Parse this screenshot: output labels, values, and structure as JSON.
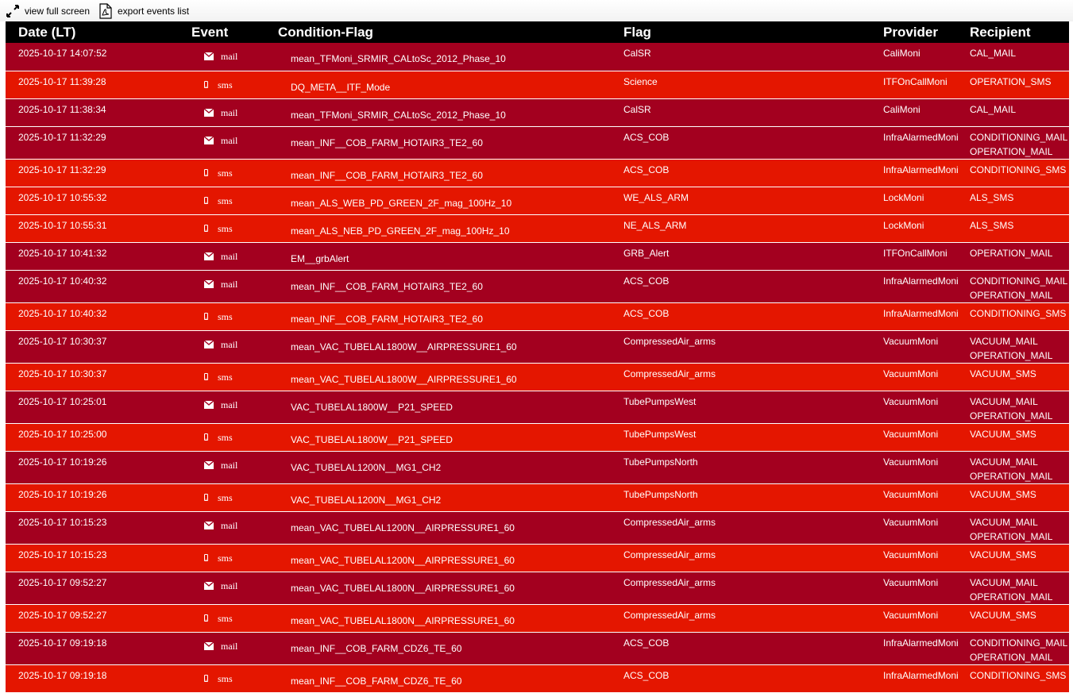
{
  "toolbar": {
    "fullscreen_label": "view full screen",
    "export_label": "export events list"
  },
  "columns": [
    "Date (LT)",
    "Event",
    "Condition-Flag",
    "Flag",
    "Provider",
    "Recipient"
  ],
  "colors": {
    "mail_row": "#a3001f",
    "sms_row": "#e41600",
    "header_bg": "#000000"
  },
  "rows": [
    {
      "date": "2025-10-17 14:07:52",
      "event": "mail",
      "condition": "mean_TFMoni_SRMIR_CALtoSc_2012_Phase_10",
      "flag": "CalSR",
      "provider": "CaliMoni",
      "recipients": [
        "CAL_MAIL"
      ]
    },
    {
      "date": "2025-10-17 11:39:28",
      "event": "sms",
      "condition": "DQ_META__ITF_Mode",
      "flag": "Science",
      "provider": "ITFOnCallMoni",
      "recipients": [
        "OPERATION_SMS"
      ]
    },
    {
      "date": "2025-10-17 11:38:34",
      "event": "mail",
      "condition": "mean_TFMoni_SRMIR_CALtoSc_2012_Phase_10",
      "flag": "CalSR",
      "provider": "CaliMoni",
      "recipients": [
        "CAL_MAIL"
      ]
    },
    {
      "date": "2025-10-17 11:32:29",
      "event": "mail",
      "condition": "mean_INF__COB_FARM_HOTAIR3_TE2_60",
      "flag": "ACS_COB",
      "provider": "InfraAlarmedMoni",
      "recipients": [
        "CONDITIONING_MAIL",
        "OPERATION_MAIL"
      ]
    },
    {
      "date": "2025-10-17 11:32:29",
      "event": "sms",
      "condition": "mean_INF__COB_FARM_HOTAIR3_TE2_60",
      "flag": "ACS_COB",
      "provider": "InfraAlarmedMoni",
      "recipients": [
        "CONDITIONING_SMS"
      ]
    },
    {
      "date": "2025-10-17 10:55:32",
      "event": "sms",
      "condition": "mean_ALS_WEB_PD_GREEN_2F_mag_100Hz_10",
      "flag": "WE_ALS_ARM",
      "provider": "LockMoni",
      "recipients": [
        "ALS_SMS"
      ]
    },
    {
      "date": "2025-10-17 10:55:31",
      "event": "sms",
      "condition": "mean_ALS_NEB_PD_GREEN_2F_mag_100Hz_10",
      "flag": "NE_ALS_ARM",
      "provider": "LockMoni",
      "recipients": [
        "ALS_SMS"
      ]
    },
    {
      "date": "2025-10-17 10:41:32",
      "event": "mail",
      "condition": "EM__grbAlert",
      "flag": "GRB_Alert",
      "provider": "ITFOnCallMoni",
      "recipients": [
        "OPERATION_MAIL"
      ]
    },
    {
      "date": "2025-10-17 10:40:32",
      "event": "mail",
      "condition": "mean_INF__COB_FARM_HOTAIR3_TE2_60",
      "flag": "ACS_COB",
      "provider": "InfraAlarmedMoni",
      "recipients": [
        "CONDITIONING_MAIL",
        "OPERATION_MAIL"
      ]
    },
    {
      "date": "2025-10-17 10:40:32",
      "event": "sms",
      "condition": "mean_INF__COB_FARM_HOTAIR3_TE2_60",
      "flag": "ACS_COB",
      "provider": "InfraAlarmedMoni",
      "recipients": [
        "CONDITIONING_SMS"
      ]
    },
    {
      "date": "2025-10-17 10:30:37",
      "event": "mail",
      "condition": "mean_VAC_TUBELAL1800W__AIRPRESSURE1_60",
      "flag": "CompressedAir_arms",
      "provider": "VacuumMoni",
      "recipients": [
        "VACUUM_MAIL",
        "OPERATION_MAIL"
      ]
    },
    {
      "date": "2025-10-17 10:30:37",
      "event": "sms",
      "condition": "mean_VAC_TUBELAL1800W__AIRPRESSURE1_60",
      "flag": "CompressedAir_arms",
      "provider": "VacuumMoni",
      "recipients": [
        "VACUUM_SMS"
      ]
    },
    {
      "date": "2025-10-17 10:25:01",
      "event": "mail",
      "condition": "VAC_TUBELAL1800W__P21_SPEED",
      "flag": "TubePumpsWest",
      "provider": "VacuumMoni",
      "recipients": [
        "VACUUM_MAIL",
        "OPERATION_MAIL"
      ]
    },
    {
      "date": "2025-10-17 10:25:00",
      "event": "sms",
      "condition": "VAC_TUBELAL1800W__P21_SPEED",
      "flag": "TubePumpsWest",
      "provider": "VacuumMoni",
      "recipients": [
        "VACUUM_SMS"
      ]
    },
    {
      "date": "2025-10-17 10:19:26",
      "event": "mail",
      "condition": "VAC_TUBELAL1200N__MG1_CH2",
      "flag": "TubePumpsNorth",
      "provider": "VacuumMoni",
      "recipients": [
        "VACUUM_MAIL",
        "OPERATION_MAIL"
      ]
    },
    {
      "date": "2025-10-17 10:19:26",
      "event": "sms",
      "condition": "VAC_TUBELAL1200N__MG1_CH2",
      "flag": "TubePumpsNorth",
      "provider": "VacuumMoni",
      "recipients": [
        "VACUUM_SMS"
      ]
    },
    {
      "date": "2025-10-17 10:15:23",
      "event": "mail",
      "condition": "mean_VAC_TUBELAL1200N__AIRPRESSURE1_60",
      "flag": "CompressedAir_arms",
      "provider": "VacuumMoni",
      "recipients": [
        "VACUUM_MAIL",
        "OPERATION_MAIL"
      ]
    },
    {
      "date": "2025-10-17 10:15:23",
      "event": "sms",
      "condition": "mean_VAC_TUBELAL1200N__AIRPRESSURE1_60",
      "flag": "CompressedAir_arms",
      "provider": "VacuumMoni",
      "recipients": [
        "VACUUM_SMS"
      ]
    },
    {
      "date": "2025-10-17 09:52:27",
      "event": "mail",
      "condition": "mean_VAC_TUBELAL1800N__AIRPRESSURE1_60",
      "flag": "CompressedAir_arms",
      "provider": "VacuumMoni",
      "recipients": [
        "VACUUM_MAIL",
        "OPERATION_MAIL"
      ]
    },
    {
      "date": "2025-10-17 09:52:27",
      "event": "sms",
      "condition": "mean_VAC_TUBELAL1800N__AIRPRESSURE1_60",
      "flag": "CompressedAir_arms",
      "provider": "VacuumMoni",
      "recipients": [
        "VACUUM_SMS"
      ]
    },
    {
      "date": "2025-10-17 09:19:18",
      "event": "mail",
      "condition": "mean_INF__COB_FARM_CDZ6_TE_60",
      "flag": "ACS_COB",
      "provider": "InfraAlarmedMoni",
      "recipients": [
        "CONDITIONING_MAIL",
        "OPERATION_MAIL"
      ]
    },
    {
      "date": "2025-10-17 09:19:18",
      "event": "sms",
      "condition": "mean_INF__COB_FARM_CDZ6_TE_60",
      "flag": "ACS_COB",
      "provider": "InfraAlarmedMoni",
      "recipients": [
        "CONDITIONING_SMS"
      ]
    }
  ]
}
